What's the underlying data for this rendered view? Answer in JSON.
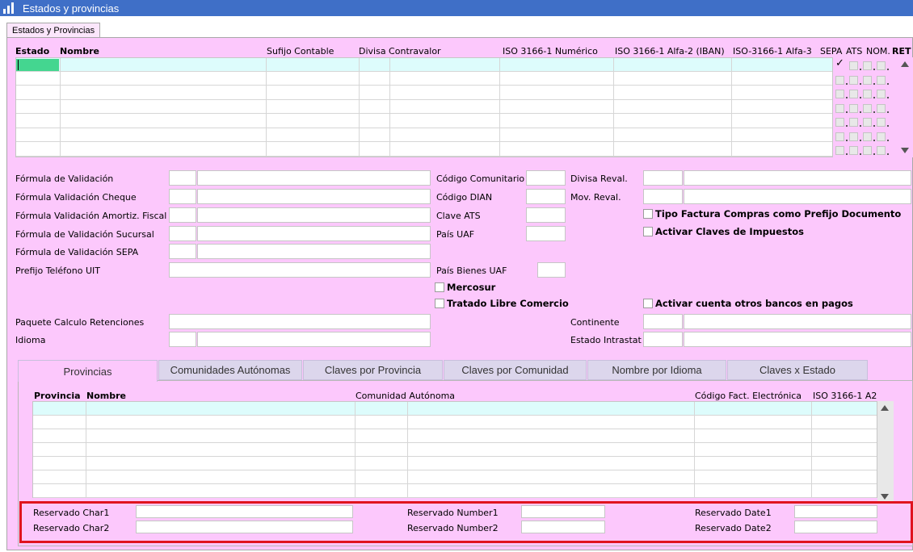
{
  "window": {
    "title": "Estados y provincias",
    "tab": "Estados y Provincias"
  },
  "grid": {
    "headers": [
      "Estado",
      "Nombre",
      "Sufijo Contable",
      "Divisa Contravalor",
      "ISO 3166-1 Numérico",
      "ISO 3166-1 Alfa-2 (IBAN)",
      "ISO-3166-1 Alfa-3",
      "SEPA",
      "ATS",
      "NOM.",
      "RET"
    ],
    "first_row_sepa_checked": true
  },
  "form": {
    "formula_validacion": "Fórmula de Validación",
    "formula_validacion_cheque": "Fórmula Validación Cheque",
    "formula_validacion_amortiz": "Fórmula Validación Amortiz. Fiscal",
    "formula_validacion_sucursal": "Fórmula de Validación Sucursal",
    "formula_validacion_sepa": "Fórmula de Validación SEPA",
    "prefijo_telefono": "Prefijo Teléfono UIT",
    "codigo_comunitario": "Código Comunitario",
    "codigo_dian": "Código DIAN",
    "clave_ats": "Clave ATS",
    "pais_uaf": "País UAF",
    "pais_bienes_uaf": "País Bienes UAF",
    "divisa_reval": "Divisa Reval.",
    "mov_reval": "Mov. Reval.",
    "tipo_factura": "Tipo Factura Compras como Prefijo Documento",
    "activar_claves": "Activar Claves de Impuestos",
    "mercosur": "Mercosur",
    "tratado": "Tratado Libre Comercio",
    "activar_cuenta": "Activar cuenta otros bancos en pagos",
    "paquete": "Paquete Calculo Retenciones",
    "idioma": "Idioma",
    "continente": "Continente",
    "estado_intrastat": "Estado Intrastat"
  },
  "tabs": [
    "Provincias",
    "Comunidades Autónomas",
    "Claves por Provincia",
    "Claves por Comunidad",
    "Nombre por Idioma",
    "Claves x Estado"
  ],
  "subgrid": {
    "headers": [
      "Provincia",
      "Nombre",
      "Comunidad Autónoma",
      "Código Fact. Electrónica",
      "ISO 3166-1 A2"
    ]
  },
  "reserved": {
    "char1": "Reservado Char1",
    "char2": "Reservado Char2",
    "number1": "Reservado Number1",
    "number2": "Reservado Number2",
    "date1": "Reservado Date1",
    "date2": "Reservado Date2"
  },
  "colors": {
    "panel": "#fcc8fc",
    "title": "#3f6fc7",
    "highlight_row": "#ddfcfc",
    "highlight_box": "#e0141e"
  }
}
